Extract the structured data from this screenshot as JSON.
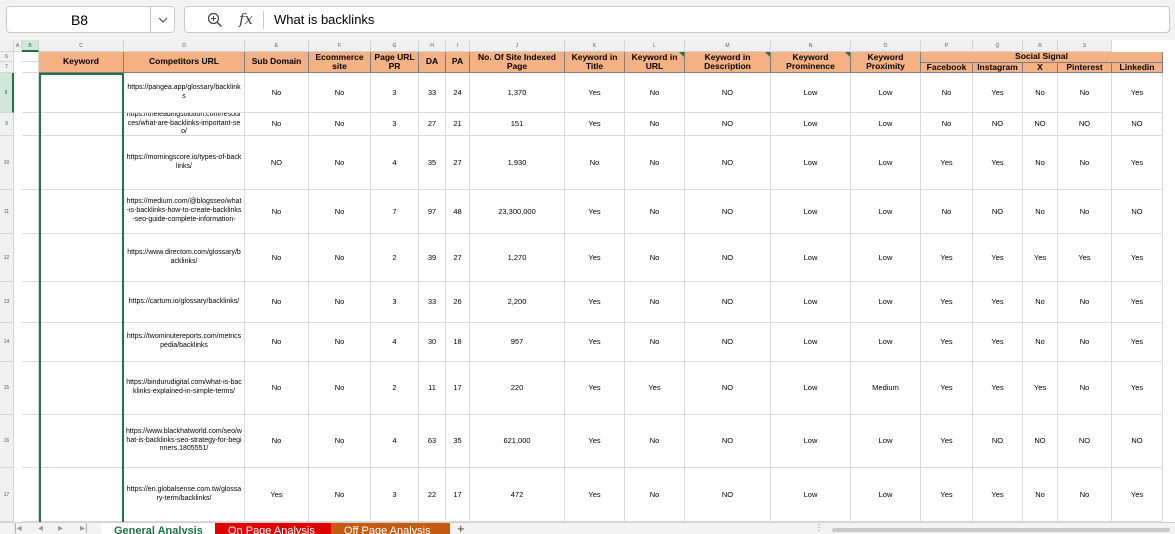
{
  "name_box": {
    "value": "B8"
  },
  "formula_bar": {
    "fx_label": "fx",
    "value": "What is backlinks"
  },
  "columns": [
    "A",
    "B",
    "C",
    "D",
    "E",
    "F",
    "G",
    "H",
    "I",
    "J",
    "K",
    "L",
    "M",
    "N",
    "O",
    "P",
    "Q",
    "R",
    "S"
  ],
  "row_numbers": [
    "6",
    "7",
    "8",
    "9",
    "10",
    "11",
    "12",
    "13",
    "14",
    "15",
    "16",
    "17"
  ],
  "headers": {
    "keyword": "Keyword",
    "competitors_url": "Competitors URL",
    "sub_domain": "Sub Domain",
    "ecommerce": "Ecommerce site",
    "page_url_pr": "Page URL PR",
    "da": "DA",
    "pa": "PA",
    "indexed": "No. Of Site Indexed Page",
    "kw_title": "Keyword in Title",
    "kw_url": "Keyword in URL",
    "kw_desc": "Keyword in Description",
    "kw_prominence": "Keyword Prominence",
    "kw_proximity": "Keyword Proximity",
    "social_signal": "Social Signal",
    "facebook": "Facebook",
    "instagram": "Instagram",
    "x": "X",
    "pinterest": "Pinterest",
    "linkedin": "Linkedin"
  },
  "rows": [
    {
      "url": "https://pangea.app/glossary/backlinks",
      "sub": "No",
      "ecom": "No",
      "pr": "3",
      "da": "33",
      "pa": "24",
      "idx": "1,370",
      "title": "Yes",
      "kurl": "No",
      "desc": "NO",
      "prom": "Low",
      "prox": "Low",
      "fb": "No",
      "ig": "Yes",
      "x": "No",
      "pin": "No",
      "li": "Yes"
    },
    {
      "url": "https://theleadingsolution.com/resources/what-are-backlinks-important-seo/",
      "sub": "No",
      "ecom": "No",
      "pr": "3",
      "da": "27",
      "pa": "21",
      "idx": "151",
      "title": "Yes",
      "kurl": "No",
      "desc": "NO",
      "prom": "Low",
      "prox": "Low",
      "fb": "No",
      "ig": "NO",
      "x": "NO",
      "pin": "NO",
      "li": "NO"
    },
    {
      "url": "https://morningscore.io/types-of-backlinks/",
      "sub": "NO",
      "ecom": "No",
      "pr": "4",
      "da": "35",
      "pa": "27",
      "idx": "1,930",
      "title": "No",
      "kurl": "No",
      "desc": "NO",
      "prom": "Low",
      "prox": "Low",
      "fb": "Yes",
      "ig": "Yes",
      "x": "No",
      "pin": "No",
      "li": "Yes"
    },
    {
      "url": "https://medium.com/@blogsseo/what-is-backlinks-how-to-create-backlinks-seo-guide-complete-information-",
      "sub": "No",
      "ecom": "No",
      "pr": "7",
      "da": "97",
      "pa": "48",
      "idx": "23,300,000",
      "title": "Yes",
      "kurl": "No",
      "desc": "NO",
      "prom": "Low",
      "prox": "Low",
      "fb": "No",
      "ig": "NO",
      "x": "No",
      "pin": "No",
      "li": "NO"
    },
    {
      "url": "https://www.directom.com/glossary/backlinks/",
      "sub": "No",
      "ecom": "No",
      "pr": "2",
      "da": "39",
      "pa": "27",
      "idx": "1,270",
      "title": "Yes",
      "kurl": "No",
      "desc": "NO",
      "prom": "Low",
      "prox": "Low",
      "fb": "Yes",
      "ig": "Yes",
      "x": "Yes",
      "pin": "Yes",
      "li": "Yes"
    },
    {
      "url": "https://cartum.io/glossary/backlinks/",
      "sub": "No",
      "ecom": "No",
      "pr": "3",
      "da": "33",
      "pa": "26",
      "idx": "2,200",
      "title": "Yes",
      "kurl": "No",
      "desc": "NO",
      "prom": "Low",
      "prox": "Low",
      "fb": "Yes",
      "ig": "Yes",
      "x": "No",
      "pin": "No",
      "li": "Yes"
    },
    {
      "url": "https://twominutereports.com/metricspedia/backlinks",
      "sub": "No",
      "ecom": "No",
      "pr": "4",
      "da": "30",
      "pa": "18",
      "idx": "957",
      "title": "Yes",
      "kurl": "No",
      "desc": "NO",
      "prom": "Low",
      "prox": "Low",
      "fb": "Yes",
      "ig": "Yes",
      "x": "No",
      "pin": "No",
      "li": "Yes"
    },
    {
      "url": "https://bindurudigital.com/what-is-backlinks-explained-in-simple-terms/",
      "sub": "No",
      "ecom": "No",
      "pr": "2",
      "da": "11",
      "pa": "17",
      "idx": "220",
      "title": "Yes",
      "kurl": "Yes",
      "desc": "NO",
      "prom": "Low",
      "prox": "Medium",
      "fb": "Yes",
      "ig": "Yes",
      "x": "Yes",
      "pin": "No",
      "li": "Yes"
    },
    {
      "url": "https://www.blackhatworld.com/seo/what-is-backlinks-seo-strategy-for-beginners.1805551/",
      "sub": "No",
      "ecom": "No",
      "pr": "4",
      "da": "63",
      "pa": "35",
      "idx": "621,000",
      "title": "Yes",
      "kurl": "No",
      "desc": "NO",
      "prom": "Low",
      "prox": "Low",
      "fb": "Yes",
      "ig": "NO",
      "x": "NO",
      "pin": "NO",
      "li": "NO"
    },
    {
      "url": "https://en.globalsense.com.tw/glossary-term/backlinks/",
      "sub": "Yes",
      "ecom": "No",
      "pr": "3",
      "da": "22",
      "pa": "17",
      "idx": "472",
      "title": "Yes",
      "kurl": "No",
      "desc": "NO",
      "prom": "Low",
      "prox": "Low",
      "fb": "Yes",
      "ig": "Yes",
      "x": "No",
      "pin": "No",
      "li": "Yes"
    }
  ],
  "sheet_tabs": [
    {
      "label": "General Analysis",
      "style": "active"
    },
    {
      "label": "On Page Analysis",
      "style": "red"
    },
    {
      "label": "Off Page Analysis",
      "style": "orange"
    }
  ],
  "add_sheet_label": "+",
  "scroll_dots": "⋮",
  "colors": {
    "header_fill": "#f4b183",
    "selection": "#217346",
    "tab_red": "#e00000",
    "tab_orange": "#c55a11"
  }
}
